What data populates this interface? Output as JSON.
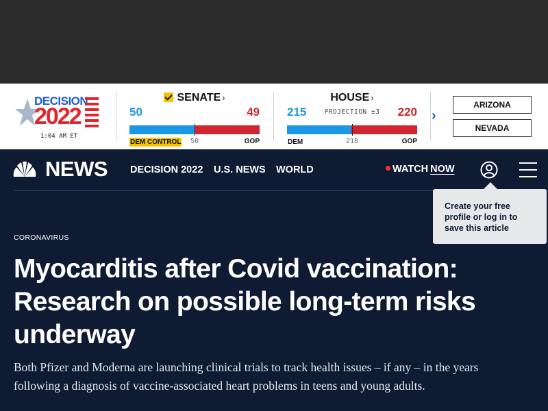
{
  "ad": {},
  "election": {
    "logo": {
      "word": "DECISION",
      "year": "2022",
      "time": "1:04 AM ET"
    },
    "senate": {
      "title": "SENATE",
      "dem_seats": "50",
      "gop_seats": "49",
      "dem_label": "DEM CONTROL",
      "gop_label": "GOP",
      "majority": "50",
      "dem_fraction": 0.5,
      "dem_control": true
    },
    "house": {
      "title": "HOUSE",
      "projection": "PROJECTION ±3",
      "dem_seats": "215",
      "gop_seats": "220",
      "dem_label": "DEM",
      "gop_label": "GOP",
      "majority": "218",
      "dem_fraction": 0.494
    },
    "states": [
      "ARIZONA",
      "NEVADA"
    ],
    "colors": {
      "dem": "#1a98e6",
      "gop": "#d1262f",
      "control": "#f5c400"
    }
  },
  "nav": {
    "brand": "NEWS",
    "links": [
      "DECISION 2022",
      "U.S. NEWS",
      "WORLD"
    ],
    "watch": "WATCH",
    "watch_now": "NOW",
    "icons": [
      "peacock-icon",
      "user-icon",
      "menu-icon"
    ]
  },
  "tooltip": {
    "text": "Create your free profile or log in to save this article"
  },
  "article": {
    "section": "CORONAVIRUS",
    "headline": "Myocarditis after Covid vaccination: Research on possible long-term risks underway",
    "dek": "Both Pfizer and Moderna are launching clinical trials to track health issues – if any – in the years following a diagnosis of vaccine-associated heart problems in teens and young adults."
  },
  "theme": {
    "background": "#0f1b33",
    "text": "#ffffff",
    "live_dot": "#ff2d2d"
  }
}
